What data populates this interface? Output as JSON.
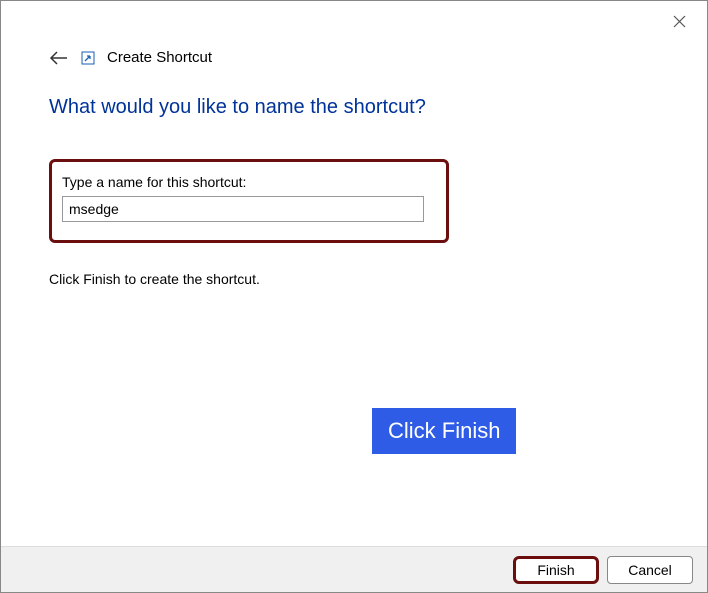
{
  "header": {
    "title": "Create Shortcut"
  },
  "main": {
    "question": "What would you like to name the shortcut?",
    "field_label": "Type a name for this shortcut:",
    "name_value": "msedge",
    "instruction": "Click Finish to create the shortcut."
  },
  "callout": {
    "text": "Click Finish"
  },
  "footer": {
    "finish_label": "Finish",
    "cancel_label": "Cancel"
  }
}
